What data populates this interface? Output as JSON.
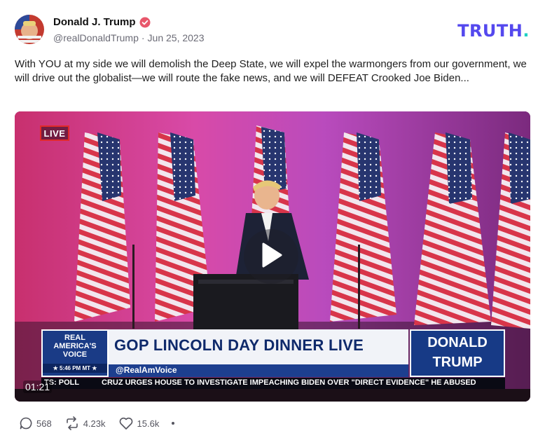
{
  "author": {
    "display_name": "Donald J. Trump",
    "handle": "@realDonaldTrump",
    "separator": "·",
    "date": "Jun 25, 2023",
    "verified": true
  },
  "brand": {
    "text": "TRUTH",
    "dot": ".",
    "color": "#5448ee",
    "dot_color": "#1fd0c3"
  },
  "post": {
    "text": "With YOU at my side we will demolish the Deep State, we will expel the warmongers from our government, we will drive out the globalist—we will route the fake news, and we will DEFEAT Crooked Joe Biden..."
  },
  "video": {
    "live_badge": "LIVE",
    "duration": "01:21",
    "chyron": {
      "network_line1": "REAL",
      "network_line2": "AMERICA'S",
      "network_line3": "VOICE",
      "time": "★ 5:46 PM MT ★",
      "title": "GOP LINCOLN DAY DINNER LIVE",
      "handle": "@RealAmVoice",
      "name_line1": "DONALD",
      "name_line2": "TRUMP"
    },
    "ticker": {
      "label": "TS: POLL",
      "text": "CRUZ URGES HOUSE TO INVESTIGATE IMPEACHING BIDEN OVER \"DIRECT EVIDENCE\" HE ABUSED"
    }
  },
  "actions": {
    "replies": "568",
    "retruths": "4.23k",
    "likes": "15.6k"
  },
  "icons": [
    "verified-badge-icon",
    "reply-icon",
    "retruth-icon",
    "heart-icon",
    "more-icon",
    "play-icon"
  ]
}
